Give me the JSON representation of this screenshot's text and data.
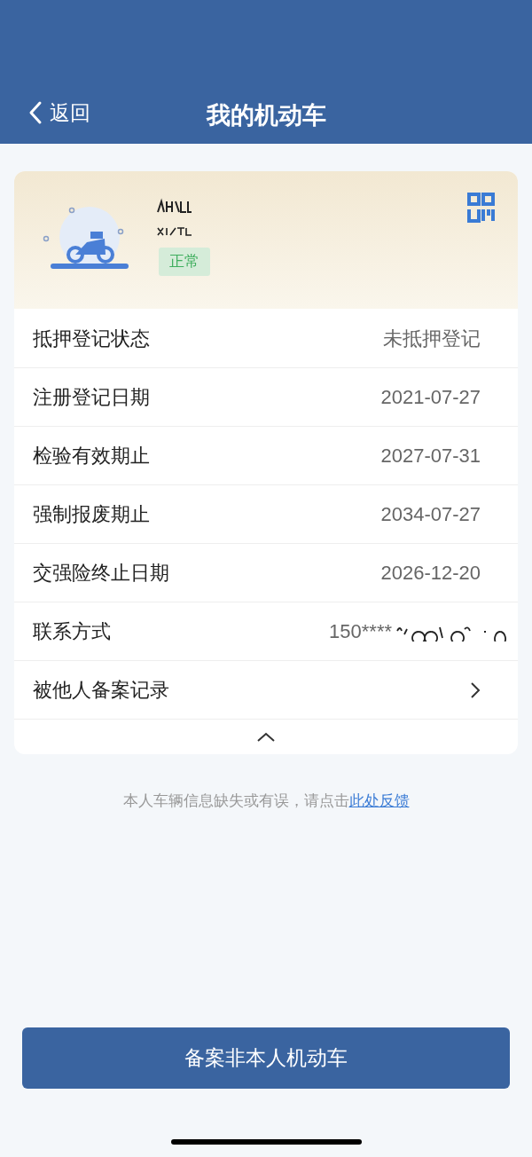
{
  "nav": {
    "back_label": "返回",
    "title": "我的机动车"
  },
  "vehicle": {
    "status_badge": "正常"
  },
  "rows": [
    {
      "kind": "value",
      "label": "抵押登记状态",
      "value": "未抵押登记"
    },
    {
      "kind": "value",
      "label": "注册登记日期",
      "value": "2021-07-27"
    },
    {
      "kind": "value",
      "label": "检验有效期止",
      "value": "2027-07-31"
    },
    {
      "kind": "value",
      "label": "强制报废期止",
      "value": "2034-07-27"
    },
    {
      "kind": "value",
      "label": "交强险终止日期",
      "value": "2026-12-20"
    },
    {
      "kind": "redacted",
      "label": "联系方式",
      "value": "150****"
    },
    {
      "kind": "link",
      "label": "被他人备案记录"
    }
  ],
  "feedback": {
    "text": "本人车辆信息缺失或有误，请点击",
    "link": "此处反馈"
  },
  "primary_button": "备案非本人机动车"
}
